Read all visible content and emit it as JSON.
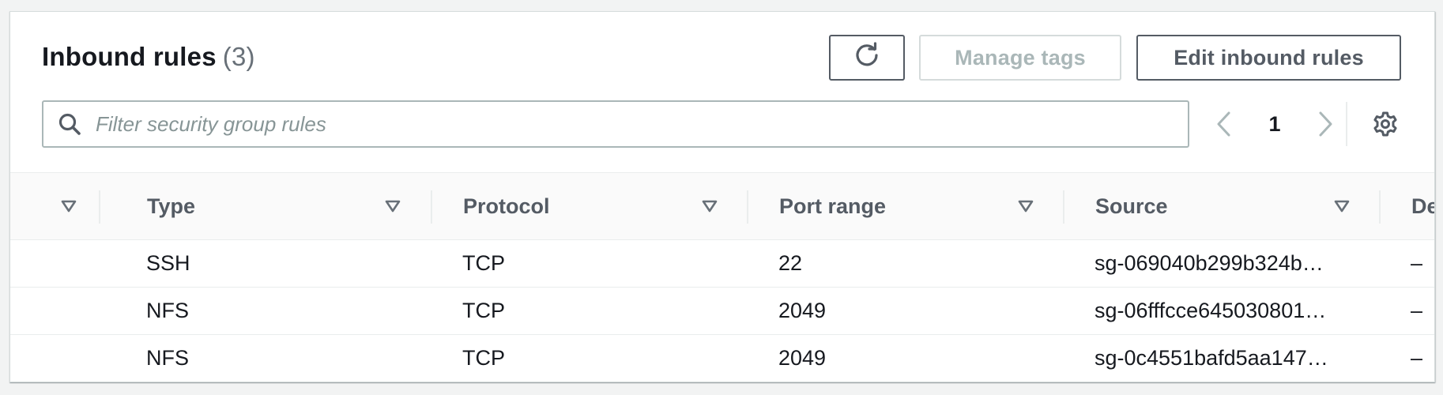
{
  "header": {
    "title": "Inbound rules",
    "count": "(3)"
  },
  "toolbar": {
    "refresh_icon": "refresh-icon",
    "manage_tags_label": "Manage tags",
    "edit_rules_label": "Edit inbound rules"
  },
  "search": {
    "placeholder": "Filter security group rules",
    "value": ""
  },
  "pagination": {
    "current_page": "1"
  },
  "table": {
    "columns": [
      "Type",
      "Protocol",
      "Port range",
      "Source",
      "De"
    ],
    "rows": [
      {
        "type": "SSH",
        "protocol": "TCP",
        "port_range": "22",
        "source": "sg-069040b299b324b…",
        "description": "–"
      },
      {
        "type": "NFS",
        "protocol": "TCP",
        "port_range": "2049",
        "source": "sg-06fffcce645030801…",
        "description": "–"
      },
      {
        "type": "NFS",
        "protocol": "TCP",
        "port_range": "2049",
        "source": "sg-0c4551bafd5aa147…",
        "description": "–"
      }
    ]
  },
  "colors": {
    "page_bg": "#f2f3f3",
    "text": "#16191f",
    "secondary_text": "#545b64",
    "disabled": "#aab7b8",
    "border": "#eaeded"
  }
}
